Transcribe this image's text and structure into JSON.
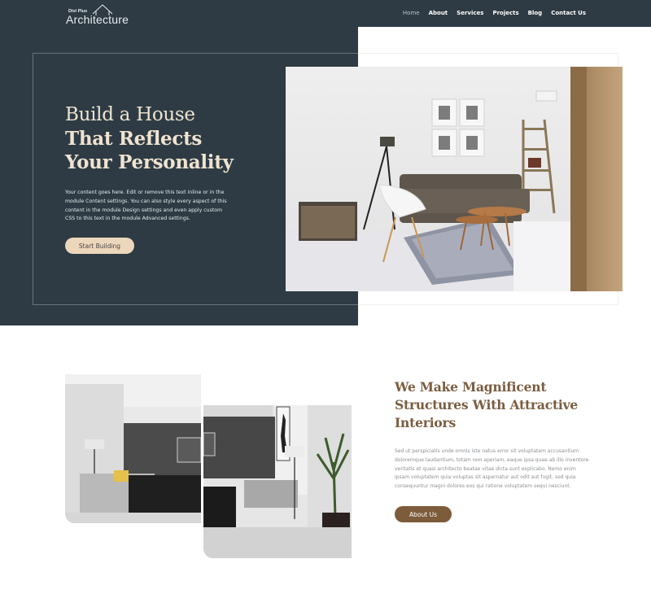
{
  "header": {
    "logo_small": "Divi Plus",
    "logo_main": "Architecture",
    "nav": [
      {
        "label": "Home",
        "active": true
      },
      {
        "label": "About",
        "active": false
      },
      {
        "label": "Services",
        "active": false
      },
      {
        "label": "Projects",
        "active": false
      },
      {
        "label": "Blog",
        "active": false
      },
      {
        "label": "Contact Us",
        "active": false
      }
    ]
  },
  "hero": {
    "title_line1": "Build a House",
    "title_line2": "That Reflects",
    "title_line3": "Your Personality",
    "body": "Your content goes here. Edit or remove this text inline or in the module Content settings. You can also style every aspect of this content in the module Design settings and even apply custom CSS to this text in the module Advanced settings.",
    "button_label": "Start Building",
    "image_icon": "living-room-photo"
  },
  "section2": {
    "title": "We Make Magnificent Structures With Attractive Interiors",
    "body": "Sed ut perspiciatis unde omnis iste natus error sit voluptatem accusantium doloremque laudantium, totam rem aperiam, eaque ipsa quae ab illo inventore veritatis et quasi architecto beatae vitae dicta sunt explicabo. Nemo enim ipsam voluptatem quia voluptas sit aspernatur aut odit aut fugit, sed quia consequuntur magni dolores eos qui ratione voluptatem sequi nesciunt.",
    "button_label": "About Us",
    "image1_icon": "interior-photo-left",
    "image2_icon": "interior-photo-right"
  },
  "colors": {
    "dark": "#2e3b44",
    "accent_light": "#ecd7bc",
    "accent_brown": "#7d5c3b",
    "heading_brown": "#7a5d40"
  }
}
